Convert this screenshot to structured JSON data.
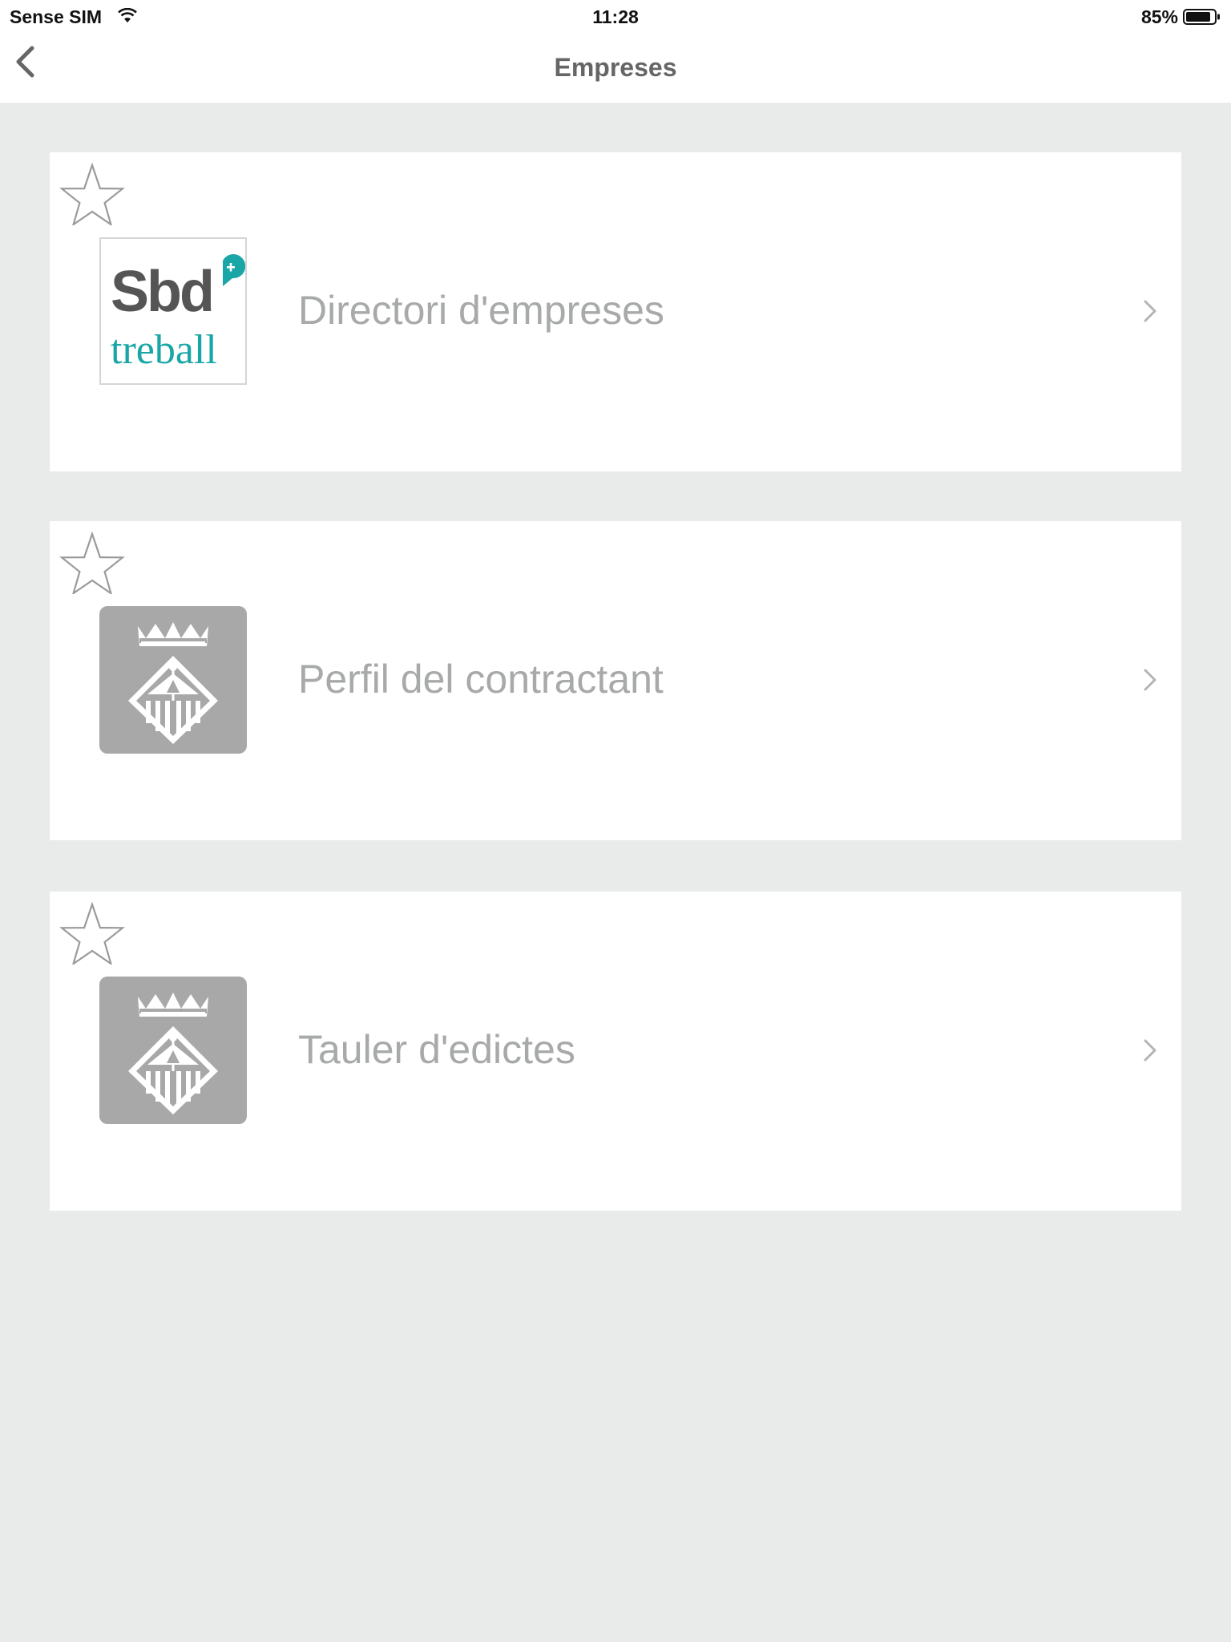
{
  "status_bar": {
    "carrier": "Sense SIM",
    "time": "11:28",
    "battery": "85%"
  },
  "nav": {
    "title": "Empreses",
    "back_icon": "chevron-left-icon"
  },
  "items": [
    {
      "label": "Directori d'empreses",
      "logo": "sbd-treball-logo",
      "logo_text_top": "Sbd",
      "logo_text_bottom": "treball",
      "favorite": false
    },
    {
      "label": "Perfil del contractant",
      "logo": "coat-of-arms-logo",
      "favorite": false
    },
    {
      "label": "Tauler d'edictes",
      "logo": "coat-of-arms-logo",
      "favorite": false
    }
  ],
  "colors": {
    "background": "#e8ebea",
    "card": "#ffffff",
    "label": "#a7aaa9",
    "brand_teal": "#1aa6a6",
    "logo_gray": "#a8a8a8"
  }
}
